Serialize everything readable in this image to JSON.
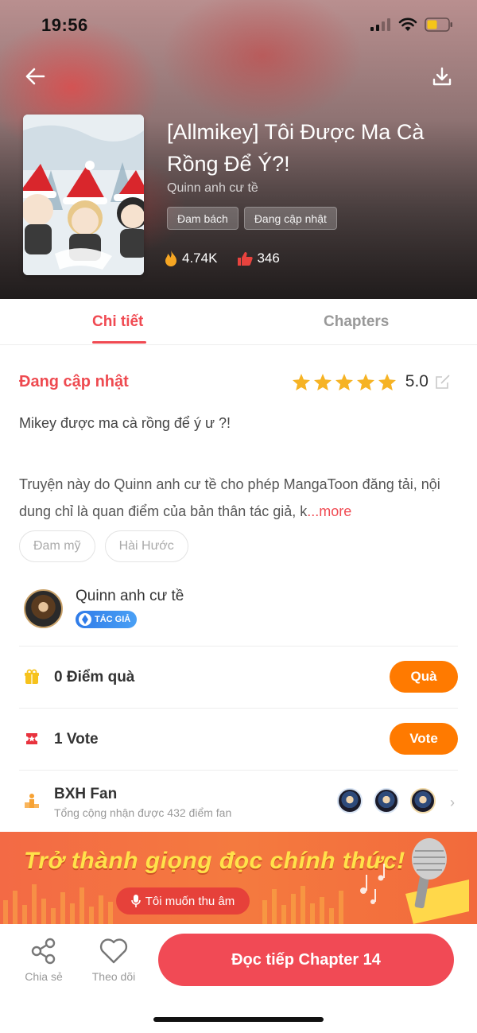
{
  "status_bar": {
    "time": "19:56"
  },
  "header": {
    "title": "[Allmikey] Tôi Được Ma Cà Rồng Để Ý?!",
    "author": "Quinn anh cư tề",
    "tags": [
      "Đam bách",
      "Đang cập nhật"
    ],
    "views": "4.74K",
    "likes": "346"
  },
  "tabs": {
    "detail": "Chi tiết",
    "chapters": "Chapters"
  },
  "detail": {
    "status": "Đang cập nhật",
    "rating": "5.0",
    "rating_stars": 5,
    "description_line": "Mikey được ma cà rồng để ý ư ?!",
    "description_body": "Truyện này do Quinn anh cư tề cho phép MangaToon đăng tải, nội dung chỉ là quan điểm của bản thân tác giả, k",
    "more": "...more",
    "genres": [
      "Đam mỹ",
      "Hài Hước"
    ]
  },
  "author_card": {
    "name": "Quinn anh cư tề",
    "badge": "TÁC GIẢ"
  },
  "gift": {
    "label": "0 Điểm quà",
    "button": "Quà"
  },
  "vote": {
    "label": "1 Vote",
    "button": "Vote"
  },
  "fan_rank": {
    "title": "BXH Fan",
    "subtitle": "Tổng cộng nhận được 432 điểm fan"
  },
  "banner": {
    "text": "Trở thành giọng đọc chính thức!",
    "button": "Tôi muốn thu âm"
  },
  "bottom_bar": {
    "share": "Chia sẻ",
    "follow": "Theo dõi",
    "read": "Đọc tiếp Chapter 14"
  },
  "colors": {
    "accent": "#f04a52",
    "orange": "#ff7a00",
    "read_button": "#f14a55"
  }
}
